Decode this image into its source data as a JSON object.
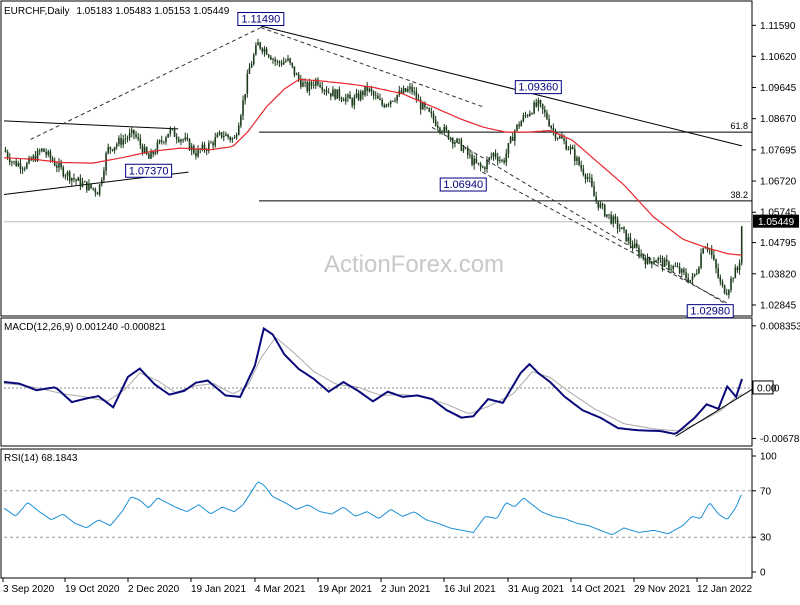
{
  "chart_data": {
    "type": "candlestick",
    "header": {
      "symbol": "EURCHF,Daily",
      "ohlc": "1.05183 1.05483 1.05153 1.05449"
    },
    "watermark": "ActionForex.com",
    "colors": {
      "candles": "#1a3a1a",
      "sma": "#e8262c",
      "macd": "#0a0a7a",
      "signal": "#aaaaaa",
      "rsi": "#1e90d6",
      "trendline": "#000000",
      "label_border": "#000080"
    },
    "x_axis": {
      "ticks": [
        "3 Sep 2020",
        "19 Oct 2020",
        "2 Dec 2020",
        "19 Jan 2021",
        "4 Mar 2021",
        "19 Apr 2021",
        "2 Jun 2021",
        "16 Jul 2021",
        "31 Aug 2021",
        "14 Oct 2021",
        "29 Nov 2021",
        "12 Jan 2022"
      ]
    },
    "price_panel": {
      "y_ticks": [
        "1.11590",
        "1.10620",
        "1.09645",
        "1.08670",
        "1.07695",
        "1.06720",
        "1.05745",
        "1.04795",
        "1.03820",
        "1.02845"
      ],
      "ylim": [
        1.0275,
        1.1185
      ],
      "current_price": "1.05449",
      "current_value": 1.05449,
      "fib_levels": [
        {
          "label": "61.8",
          "value": 1.0825
        },
        {
          "label": "38.2",
          "value": 1.061
        }
      ],
      "annotations": [
        {
          "label": "1.11490",
          "value": 1.1149,
          "day": 174
        },
        {
          "label": "1.07370",
          "value": 1.0737,
          "day": 98
        },
        {
          "label": "1.06940",
          "value": 1.0694,
          "day": 324
        },
        {
          "label": "1.09360",
          "value": 1.0936,
          "day": 362
        },
        {
          "label": "1.02980",
          "value": 1.0298,
          "day": 490
        }
      ],
      "close_anchors": [
        [
          0,
          1.077
        ],
        [
          6,
          1.073
        ],
        [
          15,
          1.072
        ],
        [
          26,
          1.077
        ],
        [
          38,
          1.071
        ],
        [
          50,
          1.067
        ],
        [
          64,
          1.064
        ],
        [
          70,
          1.077
        ],
        [
          80,
          1.08
        ],
        [
          88,
          1.082
        ],
        [
          98,
          1.074
        ],
        [
          104,
          1.078
        ],
        [
          112,
          1.083
        ],
        [
          122,
          1.08
        ],
        [
          130,
          1.076
        ],
        [
          138,
          1.078
        ],
        [
          148,
          1.082
        ],
        [
          156,
          1.08
        ],
        [
          162,
          1.092
        ],
        [
          166,
          1.102
        ],
        [
          172,
          1.11
        ],
        [
          178,
          1.108
        ],
        [
          185,
          1.104
        ],
        [
          192,
          1.105
        ],
        [
          198,
          1.1
        ],
        [
          205,
          1.096
        ],
        [
          212,
          1.099
        ],
        [
          220,
          1.095
        ],
        [
          228,
          1.094
        ],
        [
          236,
          1.092
        ],
        [
          246,
          1.096
        ],
        [
          256,
          1.091
        ],
        [
          266,
          1.094
        ],
        [
          276,
          1.096
        ],
        [
          282,
          1.091
        ],
        [
          290,
          1.087
        ],
        [
          300,
          1.082
        ],
        [
          310,
          1.078
        ],
        [
          318,
          1.073
        ],
        [
          324,
          1.071
        ],
        [
          332,
          1.076
        ],
        [
          338,
          1.073
        ],
        [
          346,
          1.083
        ],
        [
          352,
          1.087
        ],
        [
          358,
          1.09
        ],
        [
          362,
          1.091
        ],
        [
          368,
          1.087
        ],
        [
          372,
          1.083
        ],
        [
          378,
          1.08
        ],
        [
          384,
          1.077
        ],
        [
          390,
          1.072
        ],
        [
          396,
          1.068
        ],
        [
          400,
          1.062
        ],
        [
          406,
          1.058
        ],
        [
          412,
          1.055
        ],
        [
          418,
          1.052
        ],
        [
          424,
          1.048
        ],
        [
          430,
          1.045
        ],
        [
          436,
          1.042
        ],
        [
          442,
          1.043
        ],
        [
          448,
          1.041
        ],
        [
          455,
          1.04
        ],
        [
          460,
          1.038
        ],
        [
          466,
          1.036
        ],
        [
          470,
          1.04
        ],
        [
          474,
          1.048
        ],
        [
          478,
          1.046
        ],
        [
          482,
          1.04
        ],
        [
          486,
          1.034
        ],
        [
          490,
          1.033
        ],
        [
          494,
          1.038
        ],
        [
          498,
          1.04
        ],
        [
          500,
          1.0545
        ]
      ],
      "sma_anchors": [
        [
          0,
          1.0745
        ],
        [
          20,
          1.074
        ],
        [
          40,
          1.073
        ],
        [
          60,
          1.0728
        ],
        [
          80,
          1.0745
        ],
        [
          100,
          1.0765
        ],
        [
          120,
          1.0775
        ],
        [
          140,
          1.077
        ],
        [
          155,
          1.078
        ],
        [
          165,
          1.0825
        ],
        [
          178,
          1.0905
        ],
        [
          190,
          1.096
        ],
        [
          200,
          1.099
        ],
        [
          215,
          1.0985
        ],
        [
          235,
          1.0975
        ],
        [
          250,
          1.0965
        ],
        [
          270,
          1.0945
        ],
        [
          290,
          1.0905
        ],
        [
          310,
          1.0865
        ],
        [
          325,
          1.084
        ],
        [
          340,
          1.0825
        ],
        [
          355,
          1.0825
        ],
        [
          370,
          1.083
        ],
        [
          385,
          1.08
        ],
        [
          400,
          1.074
        ],
        [
          420,
          1.066
        ],
        [
          440,
          1.056
        ],
        [
          460,
          1.049
        ],
        [
          475,
          1.0465
        ],
        [
          490,
          1.0445
        ],
        [
          500,
          1.044
        ]
      ]
    },
    "macd_panel": {
      "label": "MACD(12,26,9) 0.001240 -0.000821",
      "y_ticks": [
        "0.008353",
        "0.00",
        "-0.006788"
      ],
      "ylim": [
        -0.007,
        0.0086
      ],
      "current_value": "0.00",
      "macd_anchors": [
        [
          0,
          0.0008
        ],
        [
          10,
          0.0006
        ],
        [
          22,
          -0.0003
        ],
        [
          35,
          0.0001
        ],
        [
          46,
          -0.0019
        ],
        [
          56,
          -0.0014
        ],
        [
          64,
          -0.0011
        ],
        [
          74,
          -0.0026
        ],
        [
          84,
          0.0015
        ],
        [
          92,
          0.0026
        ],
        [
          102,
          0.0005
        ],
        [
          112,
          -0.0009
        ],
        [
          122,
          -0.0004
        ],
        [
          130,
          0.0007
        ],
        [
          138,
          0.001
        ],
        [
          150,
          -0.001
        ],
        [
          160,
          -0.0012
        ],
        [
          170,
          0.003
        ],
        [
          176,
          0.008
        ],
        [
          182,
          0.0072
        ],
        [
          190,
          0.0045
        ],
        [
          200,
          0.0025
        ],
        [
          210,
          0.0012
        ],
        [
          220,
          -0.0005
        ],
        [
          230,
          0.0008
        ],
        [
          240,
          -0.0004
        ],
        [
          250,
          -0.0018
        ],
        [
          260,
          -0.0005
        ],
        [
          270,
          -0.0012
        ],
        [
          280,
          -0.001
        ],
        [
          290,
          -0.0015
        ],
        [
          300,
          -0.003
        ],
        [
          310,
          -0.004
        ],
        [
          318,
          -0.0038
        ],
        [
          328,
          -0.0015
        ],
        [
          338,
          -0.002
        ],
        [
          350,
          0.002
        ],
        [
          356,
          0.0032
        ],
        [
          362,
          0.002
        ],
        [
          370,
          0.0008
        ],
        [
          380,
          -0.0012
        ],
        [
          392,
          -0.003
        ],
        [
          404,
          -0.004
        ],
        [
          416,
          -0.0054
        ],
        [
          430,
          -0.0057
        ],
        [
          445,
          -0.0058
        ],
        [
          455,
          -0.0062
        ],
        [
          468,
          -0.004
        ],
        [
          476,
          -0.0022
        ],
        [
          484,
          -0.0028
        ],
        [
          490,
          0.0002
        ],
        [
          496,
          -0.0012
        ],
        [
          500,
          0.0012
        ]
      ],
      "signal_anchors": [
        [
          0,
          0.0006
        ],
        [
          12,
          0.0004
        ],
        [
          25,
          -0.0001
        ],
        [
          40,
          -0.0008
        ],
        [
          55,
          -0.0012
        ],
        [
          70,
          -0.0018
        ],
        [
          82,
          -0.0002
        ],
        [
          92,
          0.002
        ],
        [
          104,
          0.001
        ],
        [
          116,
          -0.0006
        ],
        [
          130,
          0.0003
        ],
        [
          142,
          0.0006
        ],
        [
          155,
          -0.0008
        ],
        [
          165,
          0.0002
        ],
        [
          174,
          0.004
        ],
        [
          184,
          0.0068
        ],
        [
          196,
          0.0048
        ],
        [
          210,
          0.0022
        ],
        [
          225,
          0.0005
        ],
        [
          240,
          0.0001
        ],
        [
          255,
          -0.001
        ],
        [
          270,
          -0.0009
        ],
        [
          285,
          -0.0012
        ],
        [
          300,
          -0.0022
        ],
        [
          315,
          -0.0035
        ],
        [
          328,
          -0.0025
        ],
        [
          345,
          -0.0008
        ],
        [
          358,
          0.0022
        ],
        [
          370,
          0.0014
        ],
        [
          385,
          -0.0008
        ],
        [
          400,
          -0.0028
        ],
        [
          420,
          -0.0048
        ],
        [
          440,
          -0.0055
        ],
        [
          458,
          -0.0058
        ],
        [
          472,
          -0.0045
        ],
        [
          486,
          -0.003
        ],
        [
          496,
          -0.0012
        ],
        [
          500,
          -0.0008
        ]
      ]
    },
    "rsi_panel": {
      "label": "RSI(14) 68.1843",
      "y_ticks": [
        "100",
        "70",
        "30",
        "0"
      ],
      "ylim": [
        0,
        100
      ],
      "levels": [
        70,
        30
      ],
      "rsi_anchors": [
        [
          0,
          55
        ],
        [
          8,
          48
        ],
        [
          16,
          60
        ],
        [
          24,
          52
        ],
        [
          32,
          45
        ],
        [
          40,
          50
        ],
        [
          48,
          42
        ],
        [
          56,
          38
        ],
        [
          64,
          45
        ],
        [
          72,
          40
        ],
        [
          80,
          52
        ],
        [
          86,
          65
        ],
        [
          92,
          62
        ],
        [
          98,
          55
        ],
        [
          104,
          64
        ],
        [
          110,
          60
        ],
        [
          116,
          56
        ],
        [
          124,
          52
        ],
        [
          132,
          58
        ],
        [
          140,
          50
        ],
        [
          148,
          56
        ],
        [
          156,
          52
        ],
        [
          162,
          58
        ],
        [
          168,
          70
        ],
        [
          172,
          78
        ],
        [
          176,
          75
        ],
        [
          182,
          65
        ],
        [
          190,
          60
        ],
        [
          198,
          54
        ],
        [
          206,
          58
        ],
        [
          214,
          52
        ],
        [
          222,
          50
        ],
        [
          230,
          56
        ],
        [
          238,
          48
        ],
        [
          246,
          52
        ],
        [
          254,
          46
        ],
        [
          262,
          54
        ],
        [
          270,
          48
        ],
        [
          278,
          52
        ],
        [
          286,
          45
        ],
        [
          294,
          42
        ],
        [
          302,
          38
        ],
        [
          310,
          36
        ],
        [
          318,
          34
        ],
        [
          326,
          48
        ],
        [
          334,
          46
        ],
        [
          340,
          60
        ],
        [
          346,
          56
        ],
        [
          352,
          64
        ],
        [
          358,
          58
        ],
        [
          364,
          52
        ],
        [
          372,
          48
        ],
        [
          380,
          46
        ],
        [
          388,
          42
        ],
        [
          396,
          40
        ],
        [
          404,
          36
        ],
        [
          412,
          32
        ],
        [
          420,
          38
        ],
        [
          430,
          34
        ],
        [
          440,
          36
        ],
        [
          450,
          33
        ],
        [
          460,
          40
        ],
        [
          466,
          48
        ],
        [
          472,
          46
        ],
        [
          478,
          60
        ],
        [
          484,
          50
        ],
        [
          490,
          45
        ],
        [
          496,
          56
        ],
        [
          500,
          68.18
        ]
      ]
    },
    "trend_lines": [
      {
        "d0": 0,
        "v0": 1.063,
        "d1": 125,
        "v1": 1.07
      },
      {
        "d0": 0,
        "v0": 1.086,
        "d1": 118,
        "v1": 1.0835
      },
      {
        "d0": 174,
        "v0": 1.1157,
        "d1": 500,
        "v1": 1.0782
      },
      {
        "d0": 18,
        "v0": 1.0802,
        "d1": 174,
        "v1": 1.1152,
        "dash": true
      },
      {
        "d0": 174,
        "v0": 1.1152,
        "d1": 324,
        "v1": 1.0905,
        "dash": true
      },
      {
        "d0": 290,
        "v0": 1.084,
        "d1": 490,
        "v1": 1.0285,
        "dash": true
      },
      {
        "d0": 324,
        "v0": 1.07,
        "d1": 490,
        "v1": 1.029,
        "dash": true
      }
    ],
    "macd_trend_line": {
      "d0": 455,
      "v0": -0.0065,
      "d1": 500,
      "v1": -0.0008
    }
  }
}
